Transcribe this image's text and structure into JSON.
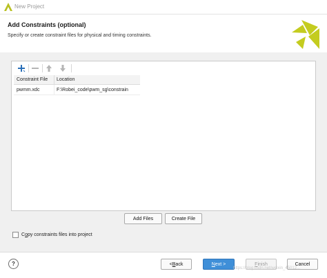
{
  "window": {
    "title": "New Project",
    "icon": "vivado-logo-icon"
  },
  "header": {
    "title": "Add Constraints (optional)",
    "subtitle": "Specify or create constraint files for physical and timing constraints."
  },
  "toolbar": {
    "icons": [
      "add-icon",
      "remove-icon",
      "move-up-icon",
      "move-down-icon"
    ]
  },
  "table": {
    "columns": [
      "Constraint File",
      "Location"
    ],
    "rows": [
      {
        "file": "pwmm.xdc",
        "location": "F:\\Robei_code\\pwm_sg\\constrain"
      }
    ]
  },
  "buttons": {
    "add_files": "Add Files",
    "create_file": "Create File"
  },
  "copy_option": {
    "label_underlined": "o",
    "label_prefix": "C",
    "label_rest": "py constraints files into project",
    "checked": false
  },
  "footer": {
    "help": "?",
    "back_prefix": "< ",
    "back_ul": "B",
    "back_rest": "ack",
    "next_ul": "N",
    "next_rest": "ext >",
    "finish_ul": "F",
    "finish_rest": "inish",
    "cancel": "Cancel"
  },
  "watermark": "https://blog.csdn.net/weixin_45012...",
  "colors": {
    "accent": "#3f8fd8",
    "logo": "#c4cc1f",
    "panel_bg": "#f0f0f0"
  }
}
